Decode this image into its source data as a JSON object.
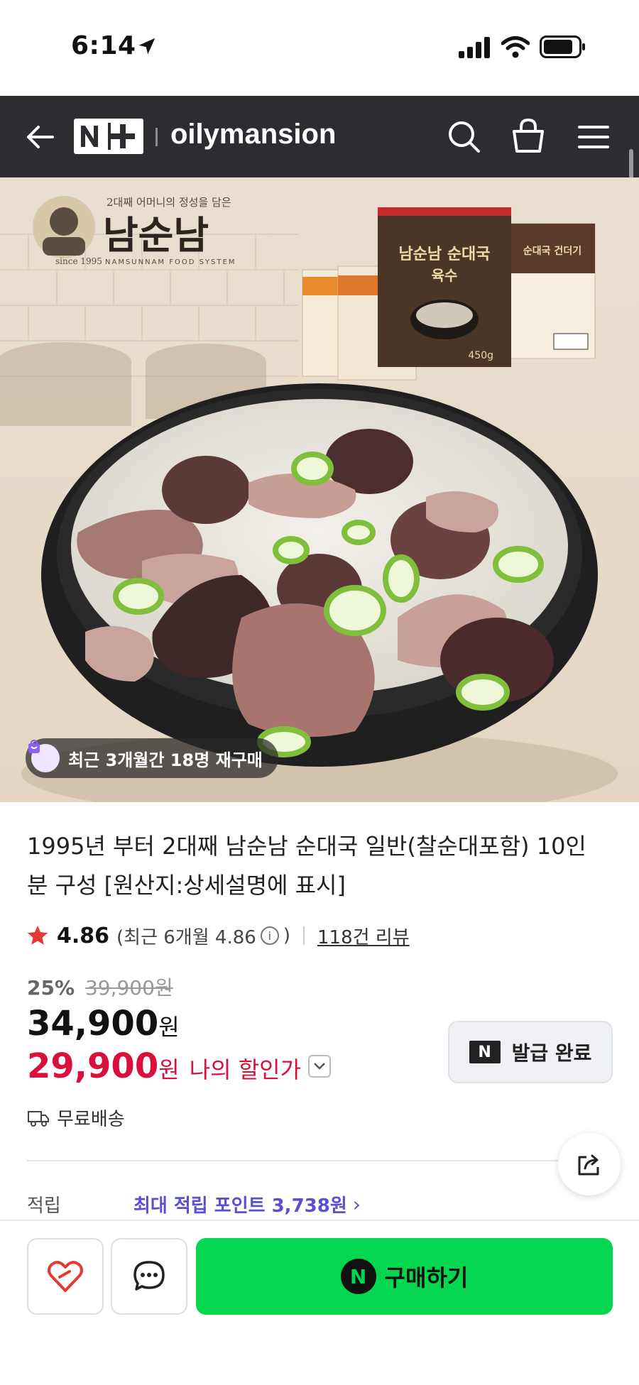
{
  "status_bar": {
    "time": "6:14"
  },
  "header": {
    "logo": "N+",
    "store_name": "oilymansion"
  },
  "hero": {
    "brand_tagline": "2대째 어머니의 정성을 담은",
    "brand_name": "남순남",
    "brand_since": "since 1995",
    "brand_system": "NAMSUNNAM FOOD SYSTEM",
    "package_main": "남순남 순대국",
    "package_main_sub": "육수",
    "package_weight": "450g",
    "package_side": "순대국 건더기",
    "repurchase_badge": "최근 3개월간 18명 재구매"
  },
  "product": {
    "title": "1995년 부터 2대째 남순남 순대국 일반(찰순대포함) 10인분 구성 [원산지:상세설명에 표시]",
    "rating": "4.86",
    "rating_recent": "(최근 6개월 4.86",
    "rating_recent_close": ")",
    "reviews": "118건 리뷰",
    "discount_rate": "25%",
    "original_price": "39,900원",
    "price": "34,900",
    "price_unit": "원",
    "my_price": "29,900",
    "my_price_unit": "원",
    "my_price_label": "나의 할인가",
    "coupon_label": "발급 완료",
    "shipping": "무료배송",
    "points_label": "적립",
    "points_value": "최대 적립 포인트 3,738원"
  },
  "bottom_bar": {
    "buy_label": "구매하기"
  },
  "colors": {
    "buy_green": "#04d64f",
    "price_red": "#d8103b",
    "points_purple": "#5a4ed1",
    "header_dark": "#2b2d31"
  }
}
